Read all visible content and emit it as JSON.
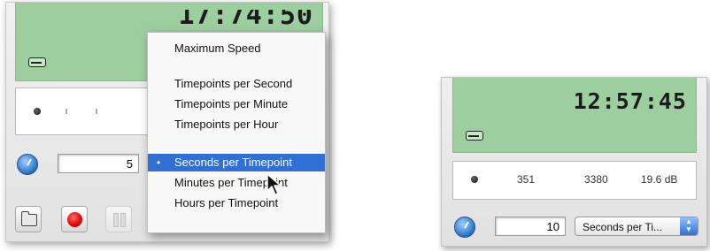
{
  "left_panel": {
    "time": "17:74:50",
    "interval_value": "5"
  },
  "menu": {
    "items": [
      {
        "label": "Maximum Speed",
        "selected": false
      },
      {
        "label": "Timepoints per Second",
        "selected": false
      },
      {
        "label": "Timepoints per Minute",
        "selected": false
      },
      {
        "label": "Timepoints per Hour",
        "selected": false
      },
      {
        "label": "Seconds per Timepoint",
        "selected": true
      },
      {
        "label": "Minutes per Timepoint",
        "selected": false
      },
      {
        "label": "Hours per Timepoint",
        "selected": false
      }
    ],
    "check_mark": "•",
    "highlight_color": "#2f6fd6"
  },
  "right_panel": {
    "time": "12:57:45",
    "readout": [
      "351",
      "3380",
      "19.6 dB"
    ],
    "interval_value": "10",
    "unit_select": "Seconds per Ti..."
  },
  "colors": {
    "display_green": "#9dcea0",
    "record_red": "#e00000"
  },
  "icons": {
    "drive": "hdd-icon",
    "clock": "clock-icon",
    "folder": "folder-icon",
    "record": "record-icon",
    "pause": "pause-icon",
    "cursor": "cursor-arrow-icon"
  }
}
